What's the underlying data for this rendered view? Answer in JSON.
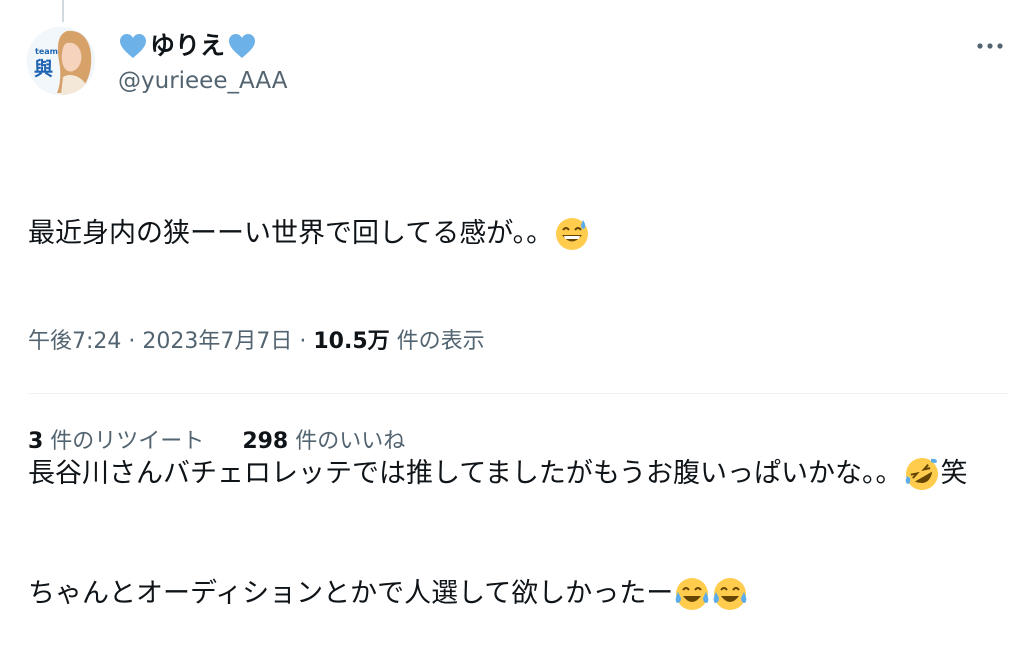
{
  "tweet": {
    "author": {
      "display_name": "ゆりえ",
      "handle": "@yurieee_AAA",
      "avatar_badge_text": "team 與"
    },
    "text": {
      "line1": "最近身内の狭ーーい世界で回してる感が。。",
      "line2": "長谷川さんバチェロレッテでは推してましたがもうお腹いっぱいかな。。",
      "line2_end": "笑",
      "line3": "ちゃんとオーディションとかで人選して欲しかったー"
    },
    "emojis": [
      "grinning-sweat-emoji",
      "rofl-emoji",
      "tears-of-joy-emoji",
      "tears-of-joy-emoji"
    ],
    "meta": {
      "time": "午後7:24",
      "separator": " · ",
      "date": "2023年7月7日",
      "views": "10.5万",
      "views_label": " 件の表示"
    },
    "stats": [
      {
        "count": "3",
        "label": " 件のリツイート"
      },
      {
        "count": "298",
        "label": " 件のいいね"
      }
    ],
    "colors": {
      "heart": "#6cb1e8",
      "text": "#0f1419",
      "secondary": "#536471",
      "divider": "#eff3f4"
    }
  }
}
